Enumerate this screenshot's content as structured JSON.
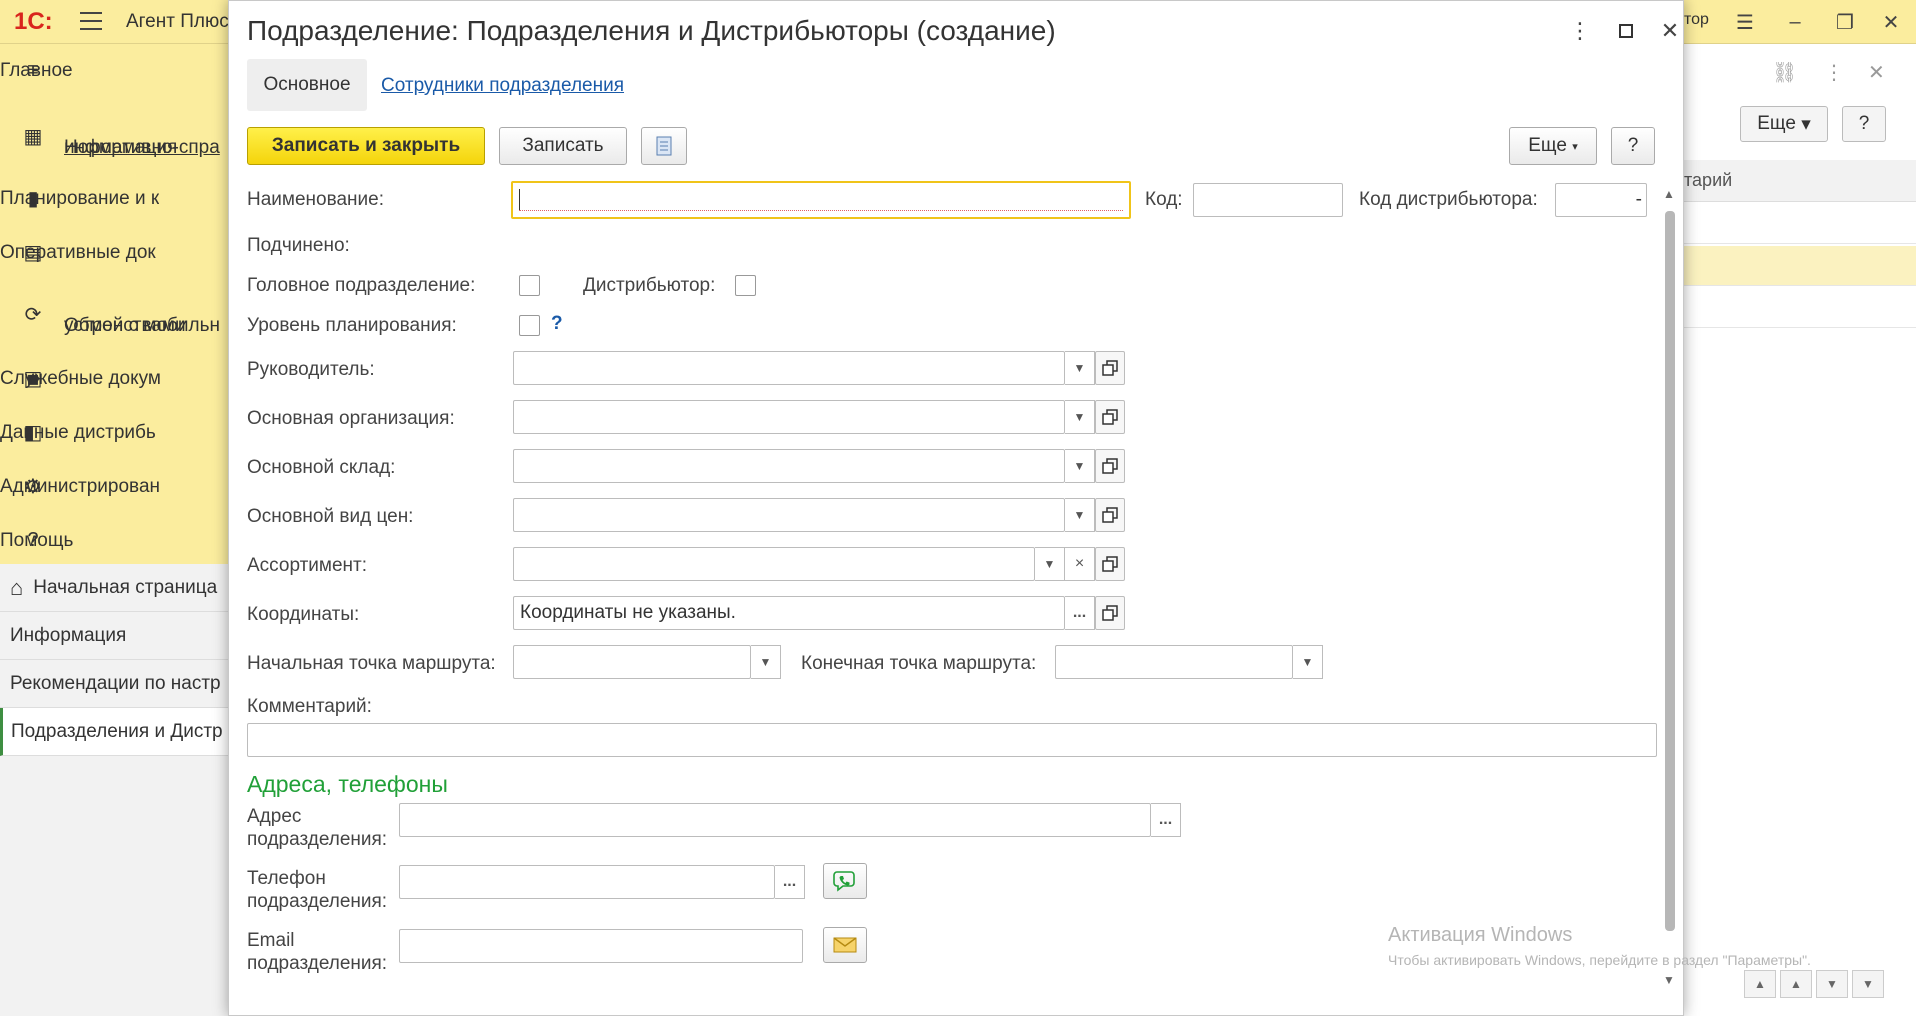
{
  "app": {
    "logo": "1С:",
    "title": "Агент Плюс",
    "user_fragment": "тор"
  },
  "sidebar": {
    "items": [
      {
        "label": "Главное",
        "icon": "menu-lines-icon"
      },
      {
        "label": "Нормативно-справочная информация",
        "line1": "Нормативно-спра",
        "line2": "информация",
        "icon": "grid-icon"
      },
      {
        "label": "Планирование и к",
        "icon": "bar-chart-icon"
      },
      {
        "label": "Оперативные док",
        "icon": "documents-icon"
      },
      {
        "label": "Обмен с мобильными устройствами",
        "line1": "Обмен с мобильн",
        "line2": "устройствами",
        "icon": "sync-icon"
      },
      {
        "label": "Служебные докум",
        "icon": "service-docs-icon"
      },
      {
        "label": "Данные дистрибь",
        "icon": "distributor-data-icon"
      },
      {
        "label": "Администрирован",
        "icon": "gear-icon"
      },
      {
        "label": "Помощь",
        "icon": "question-icon"
      }
    ]
  },
  "open_windows": [
    {
      "label": "Начальная страница",
      "icon": "home-icon"
    },
    {
      "label": "Информация"
    },
    {
      "label": "Рекомендации по настр"
    },
    {
      "label": "Подразделения и Дистр"
    }
  ],
  "background_list": {
    "more_label": "Еще",
    "help_label": "?",
    "column_header": "тарий"
  },
  "dialog": {
    "title": "Подразделение: Подразделения и Дистрибьюторы (создание)",
    "tabs": {
      "main": "Основное",
      "employees": "Сотрудники подразделения"
    },
    "toolbar": {
      "save_close": "Записать и закрыть",
      "save": "Записать",
      "more": "Еще",
      "help": "?"
    },
    "fields": {
      "name_label": "Наименование:",
      "name_value": "",
      "code_label": "Код:",
      "code_value": "",
      "distributor_code_label": "Код дистрибьютора:",
      "distributor_code_value": "-",
      "subordinate_label": "Подчинено:",
      "head_unit_label": "Головное подразделение:",
      "distributor_label": "Дистрибьютор:",
      "planning_level_label": "Уровень планирования:",
      "planning_level_help": "?",
      "manager_label": "Руководитель:",
      "main_org_label": "Основная организация:",
      "main_warehouse_label": "Основной склад:",
      "main_price_type_label": "Основной вид цен:",
      "assortment_label": "Ассортимент:",
      "coordinates_label": "Координаты:",
      "coordinates_value": "Координаты не указаны.",
      "route_start_label": "Начальная точка маршрута:",
      "route_end_label": "Конечная точка маршрута:",
      "comment_label": "Комментарий:",
      "comment_value": ""
    },
    "addresses": {
      "section_title": "Адреса, телефоны",
      "address_label_1": "Адрес",
      "address_label_2": "подразделения:",
      "phone_label_1": "Телефон",
      "phone_label_2": "подразделения:",
      "email_label_1": "Email",
      "email_label_2": "подразделения:",
      "ellipsis": "..."
    }
  },
  "watermark": {
    "title": "Активация Windows",
    "subtitle": "Чтобы активировать Windows, перейдите в раздел \"Параметры\"."
  },
  "colors": {
    "topbar": "#fbed9e",
    "primary_button": "#f4d40b",
    "section_green": "#21a038",
    "link_blue": "#1a5aa8",
    "focus_border": "#f0c419"
  }
}
